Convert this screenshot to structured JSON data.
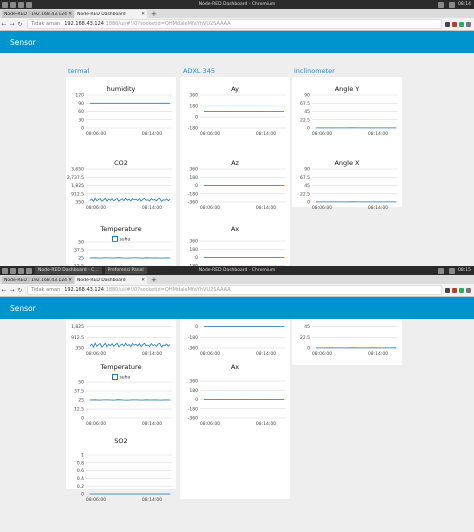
{
  "os": {
    "window_title": "Node-RED Dashboard - Chromium",
    "clock_1": "08:14",
    "clock_2": "08:15"
  },
  "tabs": [
    {
      "label": "Node-RED : 192.168.43.124"
    },
    {
      "label": "Node-RED Dashboard"
    }
  ],
  "tabs2": [
    {
      "label": "Node-RED : 192.168.43.124"
    },
    {
      "label": "Node-RED Dashboard"
    }
  ],
  "taskbar": {
    "task_1": "Node-RED Dashboard - C...",
    "task_2": "Preferensi Panel"
  },
  "address": {
    "security": "Tidak aman",
    "host": "192.168.43.124",
    "path": ":1880/ui/#!/0?socketid=QHMdaleMfaYhVU2SAAAA"
  },
  "address2": {
    "path": ":1880/ui/#!/0?socketid=QHMdaleMfaYhVU2SAAAA"
  },
  "header": {
    "title": "Sensor"
  },
  "groups": {
    "g1": "termal",
    "g2": "ADXL 345",
    "g3": "inclinometer"
  },
  "widgets": {
    "humidity": "humidity",
    "co2": "CO2",
    "temperature": "Temperature",
    "ay": "Ay",
    "az": "Az",
    "ax": "Ax",
    "so2": "SO2",
    "angle_y": "Angle Y",
    "angle_x": "Angle X"
  },
  "legend": {
    "temperature": "suhu"
  },
  "chart_data": [
    {
      "id": "humidity",
      "type": "line",
      "title": "humidity",
      "yticks": [
        "120",
        "90",
        "60",
        "30",
        "0"
      ],
      "xticks": [
        "08:06:00",
        "08:14:00"
      ],
      "ylim": [
        0,
        120
      ],
      "values": [
        90,
        90,
        90,
        90,
        90,
        90,
        90,
        90,
        90,
        90
      ]
    },
    {
      "id": "co2",
      "type": "line",
      "title": "CO2",
      "yticks": [
        "3,650",
        "2,737.5",
        "1,825",
        "912.5",
        "350"
      ],
      "xticks": [
        "08:06:00",
        "08:14:00"
      ],
      "ylim": [
        350,
        3650
      ],
      "values": [
        500,
        650,
        420,
        720,
        480,
        600,
        690,
        430,
        560,
        710,
        450,
        640,
        520,
        680,
        470,
        610,
        700,
        440,
        580,
        660,
        490,
        720,
        530,
        620,
        460,
        690,
        570,
        640,
        500,
        680,
        450,
        610,
        710,
        520,
        580,
        460,
        690,
        540,
        600,
        470,
        650,
        700,
        430,
        580,
        520,
        660,
        480,
        610
      ]
    },
    {
      "id": "ay",
      "type": "line",
      "title": "Ay",
      "yticks": [
        "360",
        "180",
        "0",
        "-180"
      ],
      "xticks": [
        "08:06:00",
        "08:14:00"
      ],
      "ylim": [
        -360,
        360
      ],
      "values": [
        0,
        0,
        0,
        0,
        0,
        0,
        0,
        0
      ]
    },
    {
      "id": "az",
      "type": "line",
      "title": "Az",
      "yticks": [
        "360",
        "180",
        "0",
        "-180",
        "-360"
      ],
      "xticks": [
        "08:06:00",
        "08:14:00"
      ],
      "ylim": [
        -360,
        360
      ],
      "values": [
        0,
        0,
        0,
        0,
        0,
        0,
        0,
        0
      ]
    },
    {
      "id": "angle_y",
      "type": "line",
      "title": "Angle Y",
      "yticks": [
        "90",
        "67.5",
        "45",
        "22.5",
        "0"
      ],
      "xticks": [
        "08:06:00",
        "08:14:00"
      ],
      "ylim": [
        0,
        90
      ],
      "values": [
        0.3,
        0.2,
        0.4,
        0.2,
        0.3,
        0.5,
        0.2,
        0.3,
        0.4,
        0.2,
        0.3,
        0.4
      ]
    },
    {
      "id": "angle_x",
      "type": "line",
      "title": "Angle X",
      "yticks": [
        "90",
        "67.5",
        "45",
        "22.5",
        "0"
      ],
      "xticks": [
        "08:06:00",
        "08:14:00"
      ],
      "ylim": [
        0,
        90
      ],
      "values": [
        0.3,
        0.2,
        0.4,
        0.2,
        0.3,
        0.5,
        0.2,
        0.3,
        0.4,
        0.2,
        0.3,
        0.4
      ]
    },
    {
      "id": "temperature",
      "type": "line",
      "title": "Temperature",
      "yticks": [
        "50",
        "37.5",
        "25",
        "12.5",
        "0"
      ],
      "xticks": [
        "08:06:00",
        "08:14:00"
      ],
      "ylim": [
        0,
        50
      ],
      "series_name": "suhu",
      "values": [
        25,
        25.3,
        24.8,
        25.1,
        25.2,
        24.9,
        25.4,
        25,
        24.8,
        25.2,
        25.1,
        24.9,
        25.3,
        25,
        25.1,
        24.8,
        25.2,
        25
      ]
    },
    {
      "id": "ax",
      "type": "line",
      "title": "Ax",
      "yticks": [
        "360",
        "180",
        "0",
        "-180",
        "-360"
      ],
      "xticks": [
        "08:06:00",
        "08:14:00"
      ],
      "ylim": [
        -360,
        360
      ],
      "values": [
        0,
        0,
        0,
        0,
        0,
        0,
        0,
        0
      ]
    },
    {
      "id": "so2",
      "type": "line",
      "title": "SO2",
      "yticks": [
        "1",
        "0.8",
        "0.6",
        "0.4",
        "0.2",
        "0"
      ],
      "xticks": [
        "08:06:00",
        "08:14:00"
      ],
      "ylim": [
        0,
        1
      ],
      "values": [
        0,
        0,
        0,
        0,
        0,
        0,
        0,
        0
      ]
    }
  ],
  "colors": {
    "accent": "#0094ce",
    "line": "#1f77b4",
    "group_title": "#1e8bd1"
  }
}
